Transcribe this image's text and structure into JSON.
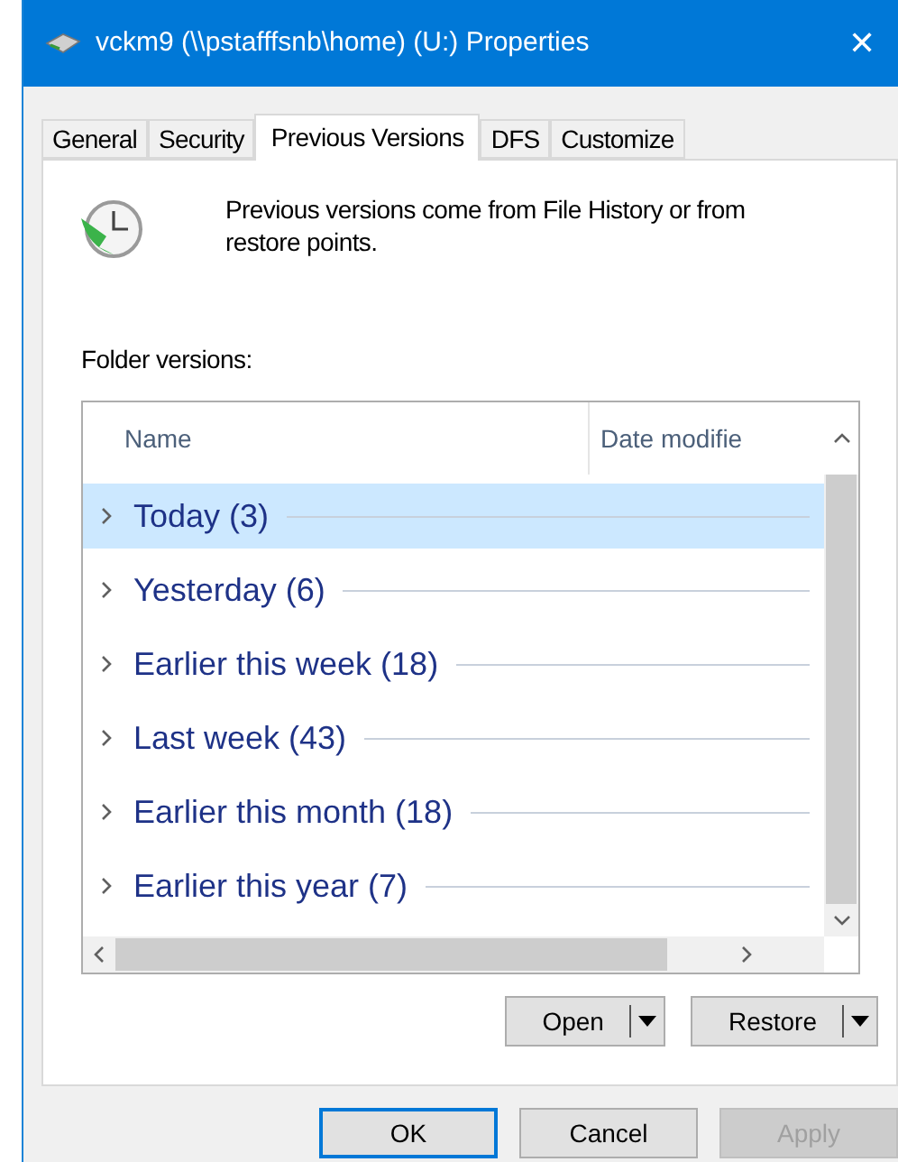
{
  "window": {
    "title": "vckm9 (\\\\pstafffsnb\\home) (U:) Properties",
    "close": "✕"
  },
  "tabs": [
    {
      "label": "General",
      "selected": false
    },
    {
      "label": "Security",
      "selected": false
    },
    {
      "label": "Previous Versions",
      "selected": true
    },
    {
      "label": "DFS",
      "selected": false
    },
    {
      "label": "Customize",
      "selected": false
    }
  ],
  "description": "Previous versions come from File History or from restore points.",
  "folder_versions": {
    "label": "Folder versions:",
    "columns": [
      "Name",
      "Date modifie"
    ],
    "rows": [
      {
        "label": "Today (3)",
        "selected": true
      },
      {
        "label": "Yesterday (6)",
        "selected": false
      },
      {
        "label": "Earlier this week (18)",
        "selected": false
      },
      {
        "label": "Last week (43)",
        "selected": false
      },
      {
        "label": "Earlier this month (18)",
        "selected": false
      },
      {
        "label": "Earlier this year (7)",
        "selected": false
      }
    ]
  },
  "actions": [
    {
      "label": "Open"
    },
    {
      "label": "Restore"
    }
  ],
  "buttons": [
    {
      "label": "OK",
      "default": true,
      "disabled": false
    },
    {
      "label": "Cancel",
      "default": false,
      "disabled": false
    },
    {
      "label": "Apply",
      "default": false,
      "disabled": true
    }
  ]
}
